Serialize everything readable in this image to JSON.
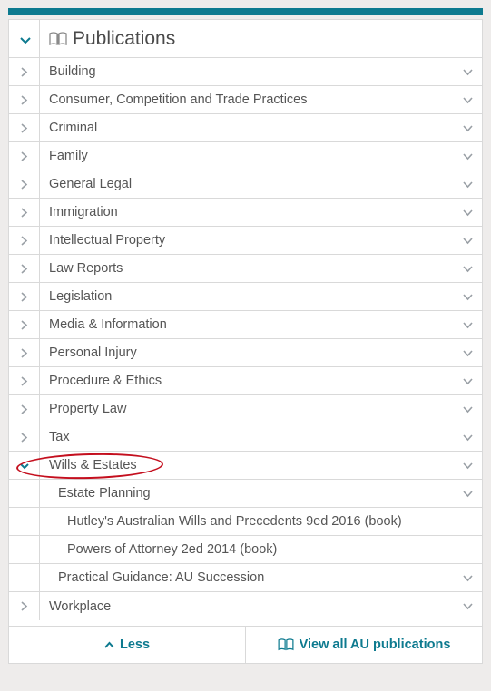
{
  "header": {
    "title": "Publications"
  },
  "items": [
    {
      "label": "Building",
      "expanded": false
    },
    {
      "label": "Consumer, Competition and Trade Practices",
      "expanded": false
    },
    {
      "label": "Criminal",
      "expanded": false
    },
    {
      "label": "Family",
      "expanded": false
    },
    {
      "label": "General Legal",
      "expanded": false
    },
    {
      "label": "Immigration",
      "expanded": false
    },
    {
      "label": "Intellectual Property",
      "expanded": false
    },
    {
      "label": "Law Reports",
      "expanded": false
    },
    {
      "label": "Legislation",
      "expanded": false
    },
    {
      "label": "Media & Information",
      "expanded": false
    },
    {
      "label": "Personal Injury",
      "expanded": false
    },
    {
      "label": "Procedure & Ethics",
      "expanded": false
    },
    {
      "label": "Property Law",
      "expanded": false
    },
    {
      "label": "Tax",
      "expanded": false
    },
    {
      "label": "Wills & Estates",
      "expanded": true,
      "highlighted": true
    },
    {
      "label": "Workplace",
      "expanded": false
    }
  ],
  "wills_subitems": [
    {
      "label": "Estate Planning",
      "indent": 1
    },
    {
      "label": "Hutley's Australian Wills and Precedents 9ed 2016 (book)",
      "indent": 2
    },
    {
      "label": "Powers of Attorney 2ed 2014 (book)",
      "indent": 2
    },
    {
      "label": "Practical Guidance: AU Succession",
      "indent": 1
    }
  ],
  "footer": {
    "less_label": "Less",
    "viewall_label": "View all AU publications"
  }
}
